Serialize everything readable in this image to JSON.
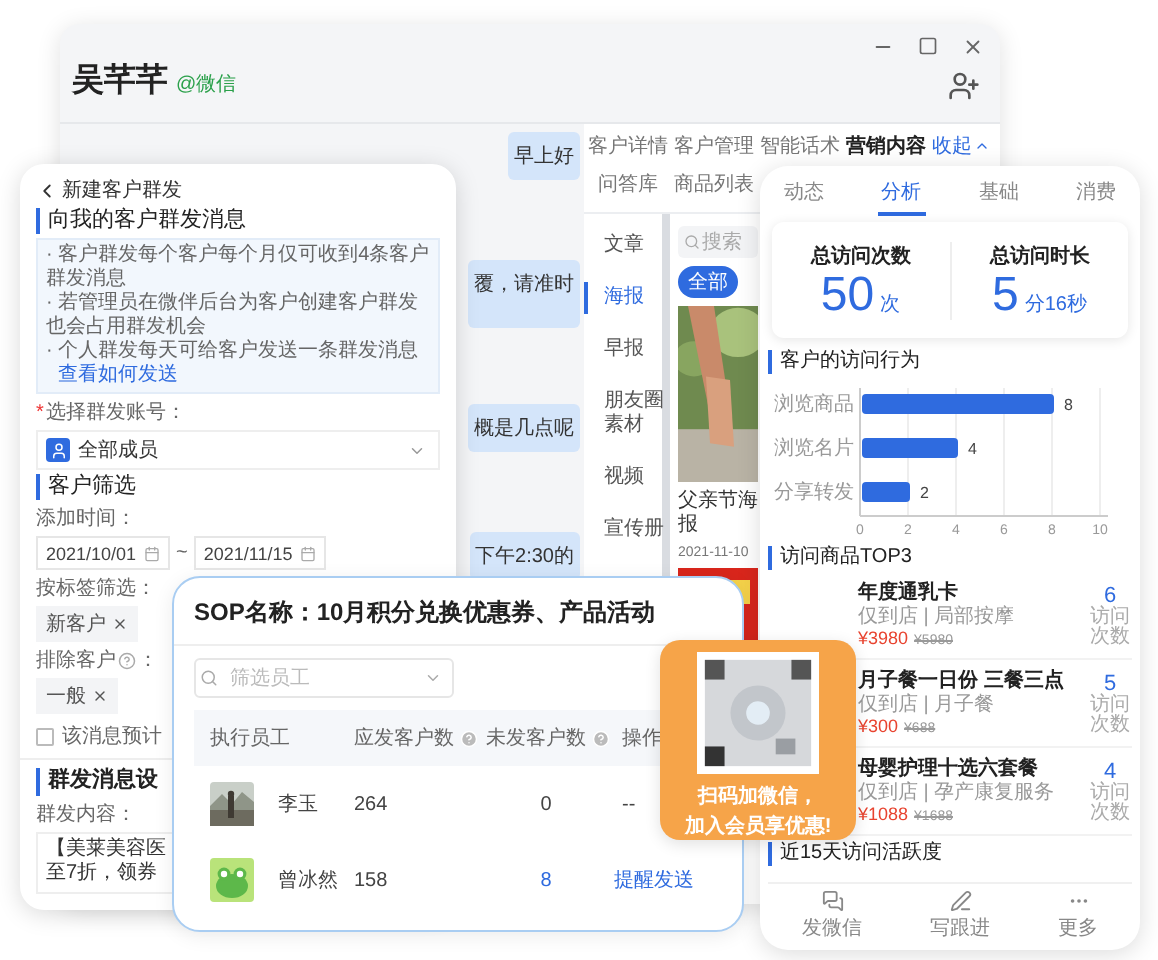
{
  "chat_window": {
    "contact_name": "吴芊芊",
    "channel": "@微信",
    "messages": [
      {
        "text": "早上好"
      },
      {
        "text": "覆，请准时"
      },
      {
        "text": "概是几点呢"
      },
      {
        "text": "下午2:30的"
      }
    ],
    "tab_rows": [
      [
        {
          "label": "客户详情",
          "selected": false
        },
        {
          "label": "客户管理",
          "selected": false
        },
        {
          "label": "智能话术",
          "selected": false
        },
        {
          "label": "营销内容",
          "selected": true
        }
      ],
      [
        {
          "label": "问答库",
          "selected": false
        },
        {
          "label": "商品列表",
          "selected": false
        }
      ]
    ],
    "collapse": "收起",
    "categories": [
      {
        "label": "文章",
        "selected": false
      },
      {
        "label": "海报",
        "selected": true
      },
      {
        "label": "早报",
        "selected": false
      },
      {
        "label": "朋友圈素材",
        "selected": false
      },
      {
        "label": "视频",
        "selected": false
      },
      {
        "label": "宣传册",
        "selected": false
      }
    ],
    "search": {
      "placeholder": "搜索"
    },
    "filter_chip": "全部",
    "material": {
      "title": "父亲节海报",
      "date": "2021-11-10"
    }
  },
  "group_send_panel": {
    "back_title": "新建客户群发",
    "heading": "向我的客户群发消息",
    "notes": [
      {
        "text": "· 客户群发每个客户每个月仅可收到4条客户群发消息"
      },
      {
        "text": "· 若管理员在微伴后台为客户创建客户群发也会占用群发机会"
      },
      {
        "text": "· 个人群发每天可给客户发送一条群发消息",
        "link": "查看如何发送"
      }
    ],
    "account_label": {
      "required_mark": "*",
      "text": "选择群发账号："
    },
    "account_value": "全部成员",
    "filter_heading": "客户筛选",
    "time_label": "添加时间：",
    "date_from": "2021/10/01",
    "date_separator": "~",
    "date_to": "2021/11/15",
    "tag_label": "按标签筛选：",
    "tags": [
      "新客户"
    ],
    "exclude_label": "排除客户",
    "exclude_colon": "：",
    "exclude_tags": [
      "一般"
    ],
    "estimate": {
      "checked": false,
      "label": "该消息预计"
    },
    "settings_heading": "群发消息设",
    "content_label": "群发内容：",
    "content_lines": [
      "【美莱美容医",
      "至7折，领券"
    ]
  },
  "sop_panel": {
    "title": "SOP名称：10月积分兑换优惠券、产品活动",
    "employee_filter": {
      "placeholder": "筛选员工"
    },
    "columns": [
      {
        "label": "执行员工",
        "help": false
      },
      {
        "label": "应发客户数",
        "help": true
      },
      {
        "label": "未发客户数",
        "help": true
      },
      {
        "label": "操作"
      }
    ],
    "rows": [
      {
        "name": "李玉",
        "due": "264",
        "unsent": "0",
        "unsent_highlight": false,
        "action": {
          "kind": "none",
          "label": "--"
        }
      },
      {
        "name": "曾冰然",
        "due": "158",
        "unsent": "8",
        "unsent_highlight": true,
        "action": {
          "kind": "link",
          "label": "提醒发送"
        }
      }
    ]
  },
  "qr_card": {
    "lines": [
      "扫码加微信，",
      "加入会员享优惠!"
    ]
  },
  "customer_panel": {
    "tabs": [
      {
        "label": "动态",
        "selected": false
      },
      {
        "label": "分析",
        "selected": true
      },
      {
        "label": "基础",
        "selected": false
      },
      {
        "label": "消费",
        "selected": false
      }
    ],
    "stats": [
      {
        "label": "总访问次数",
        "value": "50",
        "unit": "次"
      },
      {
        "label": "总访问时长",
        "value": "5",
        "unit": "分16秒"
      }
    ],
    "behavior": {
      "chart_data": {
        "type": "bar",
        "orientation": "horizontal",
        "title": "客户的访问行为",
        "categories": [
          "浏览商品",
          "浏览名片",
          "分享转发"
        ],
        "values": [
          8,
          4,
          2
        ],
        "xlim": [
          0,
          10
        ],
        "xticks": [
          0,
          2,
          4,
          6,
          8,
          10
        ],
        "data_labels": true,
        "grid": true
      }
    },
    "top_heading": "访问商品TOP3",
    "products": [
      {
        "name": "年度通乳卡",
        "tags": "仅到店 | 局部按摩",
        "price": "¥3980",
        "original_price": "¥5980",
        "count": "6",
        "count_label": "访问次数"
      },
      {
        "name": "月子餐一日份 三餐三点",
        "tags": "仅到店 | 月子餐",
        "price": "¥300",
        "original_price": "¥688",
        "count": "5",
        "count_label": "访问次数"
      },
      {
        "name": "母婴护理十选六套餐",
        "tags": "仅到店 | 孕产康复服务",
        "price": "¥1088",
        "original_price": "¥1688",
        "count": "4",
        "count_label": "访问次数"
      }
    ],
    "activity_heading": "近15天访问活跃度",
    "nav": [
      {
        "kind": "chat",
        "label": "发微信"
      },
      {
        "kind": "pen",
        "label": "写跟进"
      },
      {
        "kind": "more",
        "label": "更多"
      }
    ]
  }
}
